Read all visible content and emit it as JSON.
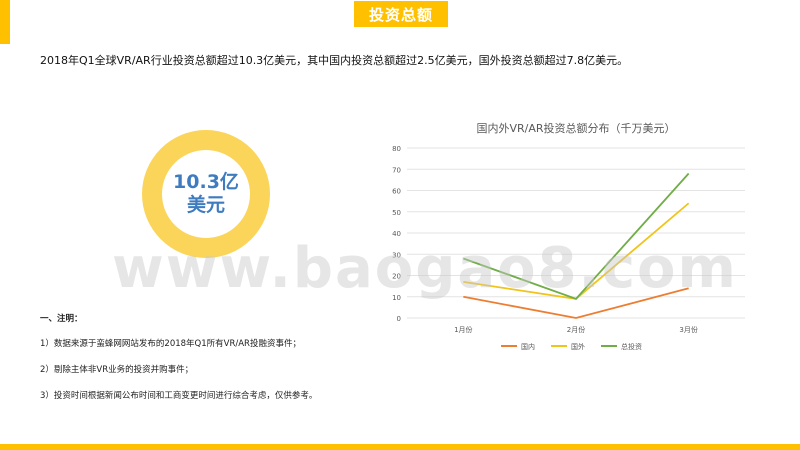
{
  "header": {
    "title": "投资总额"
  },
  "summary": "2018年Q1全球VR/AR行业投资总额超过10.3亿美元，其中国内投资总额超过2.5亿美元，国外投资总额超过7.8亿美元。",
  "donut": {
    "line1": "10.3亿",
    "line2": "美元"
  },
  "notes": {
    "heading": "一、注明：",
    "items": [
      "1）数据来源于蛮蜂网网站发布的2018年Q1所有VR/AR投融资事件；",
      "2）剔除主体非VR业务的投资并购事件；",
      "3）投资时间根据新闻公布时间和工商变更时间进行综合考虑，仅供参考。"
    ]
  },
  "watermark": "www.baogao8.com",
  "colors": {
    "accent": "#ffc000",
    "donut": "#fbd45a",
    "donut_text": "#3e7bbf"
  },
  "chart_data": {
    "type": "line",
    "title": "国内外VR/AR投资总额分布（千万美元）",
    "categories": [
      "1月份",
      "2月份",
      "3月份"
    ],
    "series": [
      {
        "name": "国内",
        "values": [
          10,
          0,
          14
        ],
        "color": "#ed7d31"
      },
      {
        "name": "国外",
        "values": [
          17,
          9,
          54
        ],
        "color": "#f0c419"
      },
      {
        "name": "总投资",
        "values": [
          28,
          9,
          68
        ],
        "color": "#70ad47"
      }
    ],
    "ylim": [
      0,
      80
    ],
    "yticks": [
      0,
      10,
      20,
      30,
      40,
      50,
      60,
      70,
      80
    ],
    "grid": true,
    "legend": "bottom"
  }
}
